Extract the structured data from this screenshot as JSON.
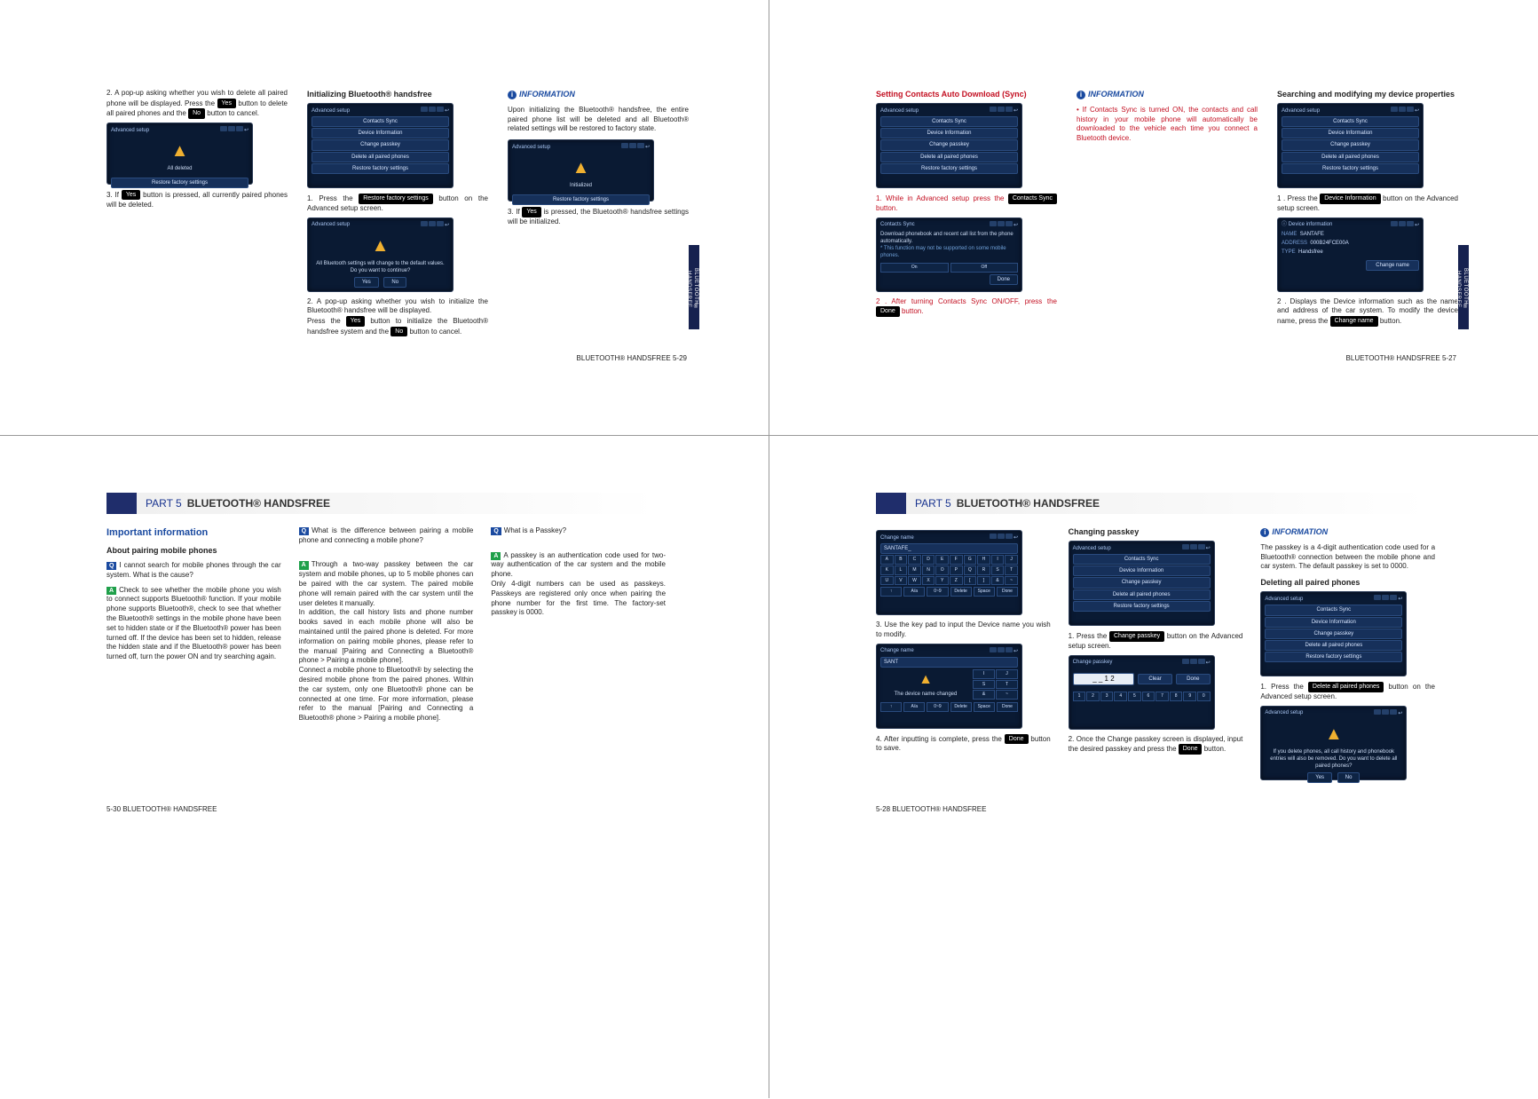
{
  "common": {
    "yes": "Yes",
    "no": "No",
    "done": "Done",
    "device_back": "↩",
    "device_icons": "icons"
  },
  "menu5": {
    "items": [
      "Contacts Sync",
      "Device Information",
      "Change passkey",
      "Delete all paired phones",
      "Restore factory settings"
    ]
  },
  "p529": {
    "footer": "BLUETOOTH® HANDSFREE   5-29",
    "side": "BLUETOOTH® HANDSFREE",
    "col1": {
      "s2": "2. A pop-up asking whether you wish to delete all paired phone will be displayed. Press the ",
      "s2b": " button to delete all paired phones and the ",
      "s2c": " button to cancel.",
      "dev1_title": "Advanced setup",
      "dev1_msg": "All deleted",
      "dev1_btn": "Restore factory settings",
      "s3a": "3. If ",
      "s3b": " button is pressed, all currently paired phones will be deleted."
    },
    "col2": {
      "h": "Initializing Bluetooth® handsfree",
      "dev_title": "Advanced setup",
      "s1a": "1. Press the ",
      "s1btn": "Restore factory settings",
      "s1b": " button on the Advanced setup screen.",
      "dev2_title": "Advanced setup",
      "dev2_msg1": "All Bluetooth settings will change to the default values.",
      "dev2_msg2": "Do you want to continue?",
      "s2": "2. A pop-up asking whether you wish to initialize the Bluetooth® handsfree will be displayed.",
      "s2b": "Press the ",
      "s2c": " button to initialize the Bluetooth® handsfree system and the ",
      "s2d": " button to cancel."
    },
    "col3": {
      "h": "INFORMATION",
      "p1": "Upon initializing the Bluetooth® handsfree, the entire paired phone list will be deleted and all Bluetooth® related settings will be restored to factory state.",
      "dev_title": "Advanced setup",
      "dev_msg": "Initialized",
      "dev_btn": "Restore factory settings",
      "s3a": "3. If ",
      "s3b": " is pressed, the Bluetooth® handsfree settings will be initialized."
    }
  },
  "p527": {
    "footer": "BLUETOOTH® HANDSFREE   5-27",
    "side": "BLUETOOTH® HANDSFREE",
    "col1": {
      "h": "Setting Contacts Auto Download (Sync)",
      "dev1_title": "Advanced setup",
      "s1a": "1. While in Advanced setup press the ",
      "s1btn": "Contacts Sync",
      "s1b": " button.",
      "dev2_title": "Contacts Sync",
      "dev2_msg": "Download phonebook and recent call list from the phone automatically.",
      "dev2_note": "* This function may not be supported on some mobile phones.",
      "dev2_on": "On",
      "dev2_off": "Off",
      "dev2_done": "Done",
      "s2a": "2 . After turning Contacts Sync ON/OFF, press the ",
      "s2b": " button."
    },
    "col2": {
      "h": "INFORMATION",
      "p1": "If Contacts Sync is turned ON, the contacts and call history in your mobile phone will automatically be downloaded to the vehicle each time you connect a Bluetooth device."
    },
    "col3": {
      "h": "Searching and modifying my device properties",
      "dev_title": "Advanced setup",
      "s1a": "1 . Press the ",
      "s1btn": "Device Information",
      "s1b": " button on the Advanced setup screen.",
      "dev2_title": "Device information",
      "dev2_rows": {
        "name_l": "NAME",
        "name_v": "SANTAFE",
        "addr_l": "ADDRESS",
        "addr_v": "000B24FCE00A",
        "type_l": "TYPE",
        "type_v": "Handsfree"
      },
      "dev2_btn": "Change name",
      "s2a": "2 . Displays the Device information such as the name and address of the car system. To modify the device name, press the ",
      "s2btn": "Change name",
      "s2b": " button."
    }
  },
  "p530": {
    "footer": "5-30   BLUETOOTH® HANDSFREE",
    "part": "PART 5",
    "title": "BLUETOOTH® HANDSFREE",
    "col1": {
      "h1": "Important information",
      "h2": "About pairing mobile phones",
      "q1": "I cannot search for mobile phones through the car system. What is the cause?",
      "a1": "Check to see whether the mobile phone you wish to connect supports Bluetooth® function. If your mobile phone supports Bluetooth®, check to see that whether the Bluetooth® settings in the mobile phone have been set to hidden state or if the Bluetooth® power has been turned off. If the device has been set to hidden, release the hidden state and if the Bluetooth® power has been turned off, turn the power ON and try searching again."
    },
    "col2": {
      "q2": "What is the difference between pairing a mobile phone and connecting a mobile phone?",
      "a2": "Through a two-way passkey between the car system and mobile phones, up to 5 mobile phones can be paired with the car system. The paired mobile phone will remain paired with the car system until the user deletes it manually.\nIn addition, the call history lists and phone number books saved in each mobile phone will also be maintained until the paired phone is deleted. For more information on pairing mobile phones, please refer to the manual [Pairing and Connecting a Bluetooth® phone > Pairing a mobile phone].\nConnect a mobile phone to Bluetooth® by selecting the desired mobile phone from the paired phones. Within the car system, only one Bluetooth® phone can be connected at one time. For more information, please refer to the manual [Pairing and Connecting a Bluetooth® phone > Pairing a mobile phone]."
    },
    "col3": {
      "q3": "What is a Passkey?",
      "a3": "A passkey is an authentication code used for two-way authentication of the car system and the mobile phone.\nOnly 4-digit numbers can be used as passkeys. Passkeys are registered only once when pairing the phone number for the first time. The factory-set passkey is 0000."
    }
  },
  "p528": {
    "footer": "5-28   BLUETOOTH® HANDSFREE",
    "part": "PART 5",
    "title": "BLUETOOTH® HANDSFREE",
    "col1": {
      "dev1_title": "Change name",
      "dev1_input": "SANTAFE_",
      "kb": {
        "r1": [
          "A",
          "B",
          "C",
          "D",
          "E",
          "F",
          "G",
          "H",
          "I",
          "J"
        ],
        "r2": [
          "K",
          "L",
          "M",
          "N",
          "O",
          "P",
          "Q",
          "R",
          "S",
          "T"
        ],
        "r3": [
          "U",
          "V",
          "W",
          "X",
          "Y",
          "Z",
          "[",
          "]",
          "&",
          "~"
        ],
        "foot": [
          "↑",
          "A/a",
          "0~9",
          "Delete",
          "Space",
          "Done"
        ]
      },
      "s3": "3. Use the key pad to input the Device name you wish to modify.",
      "dev2_title": "Change name",
      "dev2_input": "SANT",
      "dev2_msg": "The device name changed",
      "s4a": "4. After inputting is complete, press the ",
      "s4b": " button to save."
    },
    "col2": {
      "h": "Changing passkey",
      "dev_title": "Advanced setup",
      "s1a": "1. Press the ",
      "s1btn": "Change passkey",
      "s1b": " button on the Advanced setup screen.",
      "dev2_title": "Change passkey",
      "dev2_display": "_ _ 1 2",
      "dev2_clear": "Clear",
      "dev2_keys": [
        "1",
        "2",
        "3",
        "4",
        "5",
        "6",
        "7",
        "8",
        "9",
        "0"
      ],
      "s2a": "2. Once the Change passkey screen is displayed, input the desired passkey and press the ",
      "s2b": " button."
    },
    "col3": {
      "h": "INFORMATION",
      "p1": "The passkey is a 4-digit authentication code used for a Bluetooth® connection between the mobile phone and car system. The default passkey is set to 0000.",
      "h2": "Deleting all paired phones",
      "dev_title": "Advanced setup",
      "s1a": "1. Press the ",
      "s1btn": "Delete all paired phones",
      "s1b": " button on the Advanced setup screen.",
      "dev2_title": "Advanced setup",
      "dev2_msg": "If you delete phones, all call history and phonebook entries will also be removed. Do you want to delete all paired phones?"
    }
  }
}
